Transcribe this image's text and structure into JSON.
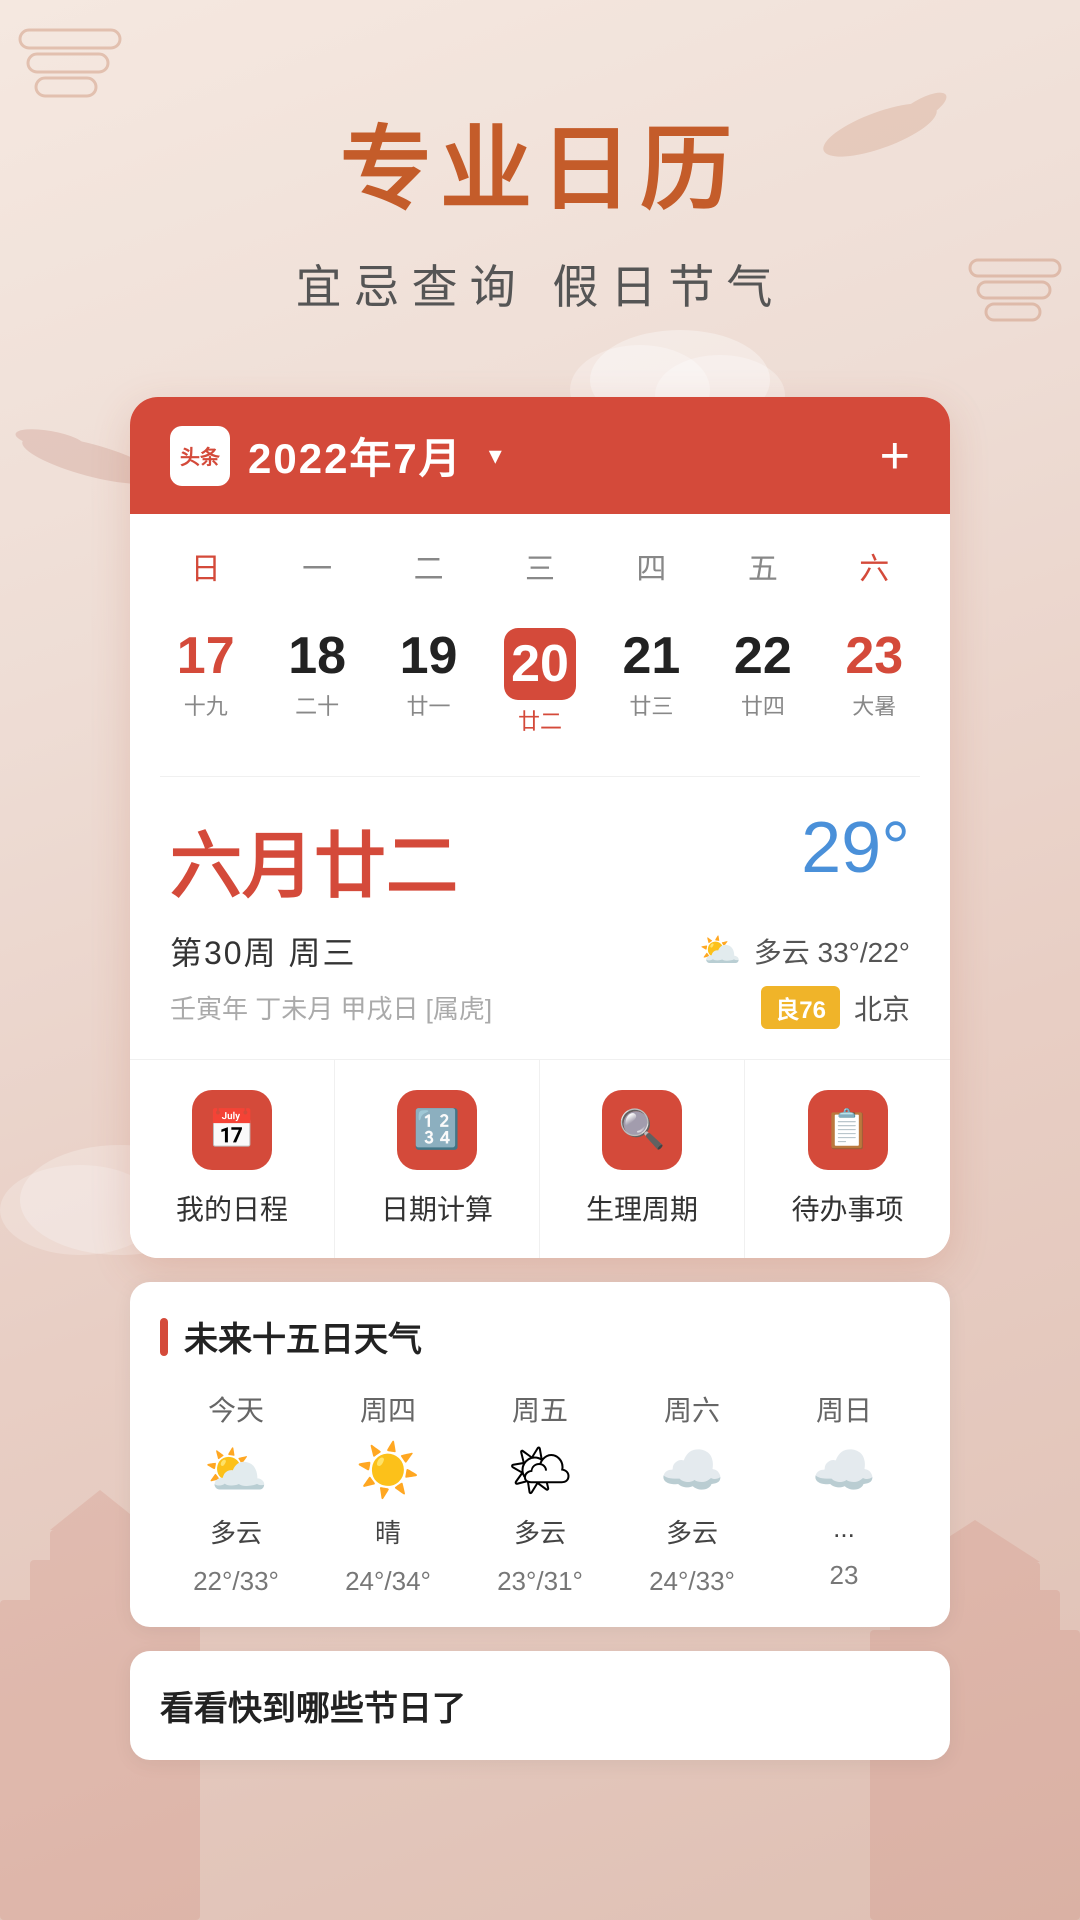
{
  "hero": {
    "title": "专业日历",
    "subtitle": "宜忌查询 假日节气"
  },
  "calendar": {
    "header": {
      "logo_text": "头条",
      "month_label": "2022年7月",
      "add_button": "+"
    },
    "day_headers": [
      "日",
      "一",
      "二",
      "三",
      "四",
      "五",
      "六"
    ],
    "dates": [
      {
        "num": "17",
        "sub": "十九",
        "red": true,
        "today": false
      },
      {
        "num": "18",
        "sub": "二十",
        "red": false,
        "today": false
      },
      {
        "num": "19",
        "sub": "廿一",
        "red": false,
        "today": false
      },
      {
        "num": "20",
        "sub": "廿二",
        "red": false,
        "today": true
      },
      {
        "num": "21",
        "sub": "廿三",
        "red": false,
        "today": false
      },
      {
        "num": "22",
        "sub": "廿四",
        "red": false,
        "today": false
      },
      {
        "num": "23",
        "sub": "大暑",
        "red": true,
        "today": false
      }
    ],
    "lunar_date": "六月廿二",
    "temperature": "29°",
    "week_info": "第30周  周三",
    "weather": {
      "condition": "多云 33°/22°",
      "icon": "⛅"
    },
    "ganzhi": "壬寅年 丁未月 甲戌日 [属虎]",
    "aqi": "良76",
    "location": "北京"
  },
  "quick_items": [
    {
      "label": "我的日程",
      "icon": "📅"
    },
    {
      "label": "日期计算",
      "icon": "🔢"
    },
    {
      "label": "生理周期",
      "icon": "🔍"
    },
    {
      "label": "待办事项",
      "icon": "📋"
    }
  ],
  "weather_forecast": {
    "section_title": "未来十五日天气",
    "items": [
      {
        "day": "今天",
        "condition": "多云",
        "temp": "22°/33°",
        "icon": "⛅"
      },
      {
        "day": "周四",
        "condition": "晴",
        "temp": "24°/34°",
        "icon": "☀️"
      },
      {
        "day": "周五",
        "condition": "多云",
        "temp": "23°/31°",
        "icon": "🌤"
      },
      {
        "day": "周六",
        "condition": "多云",
        "temp": "24°/33°",
        "icon": "☁️"
      },
      {
        "day": "周日",
        "condition": "...",
        "temp": "23",
        "icon": "☁️"
      }
    ]
  },
  "holiday_section": {
    "title": "看看快到哪些节日了"
  }
}
